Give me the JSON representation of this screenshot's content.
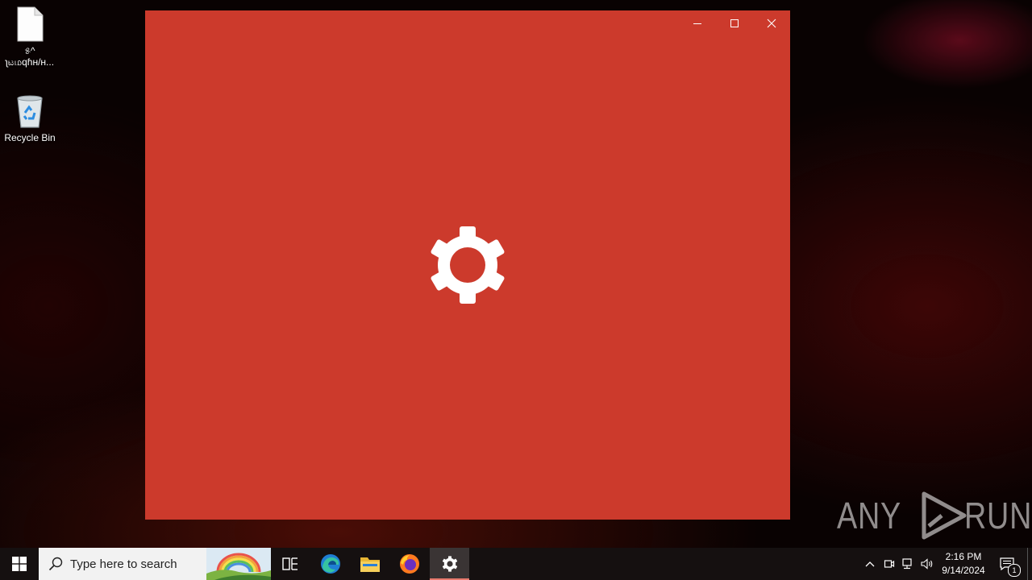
{
  "desktop": {
    "icons": [
      {
        "label_line1": "୫^",
        "label_line2": "ʅಟமqɦʜ/ʜ...",
        "icon": "blank-file-icon"
      },
      {
        "label": "Recycle Bin",
        "icon": "recycle-bin-icon"
      }
    ]
  },
  "window": {
    "background": "#cc3a2c",
    "center_icon": "gear-icon",
    "controls": {
      "minimize": "minimize-icon",
      "maximize": "maximize-icon",
      "close": "close-icon"
    }
  },
  "watermark": {
    "left": "ANY",
    "right": "RUN"
  },
  "taskbar": {
    "search_placeholder": "Type here to search",
    "apps": [
      "task-view-icon",
      "edge-icon",
      "file-explorer-icon",
      "firefox-icon",
      "settings-gear-icon"
    ],
    "active_app": "settings-gear-icon",
    "clock": {
      "time": "2:16 PM",
      "date": "9/14/2024"
    },
    "notification_count": "1"
  },
  "colors": {
    "accent": "#cc3a2c",
    "taskbar": "#151010"
  }
}
